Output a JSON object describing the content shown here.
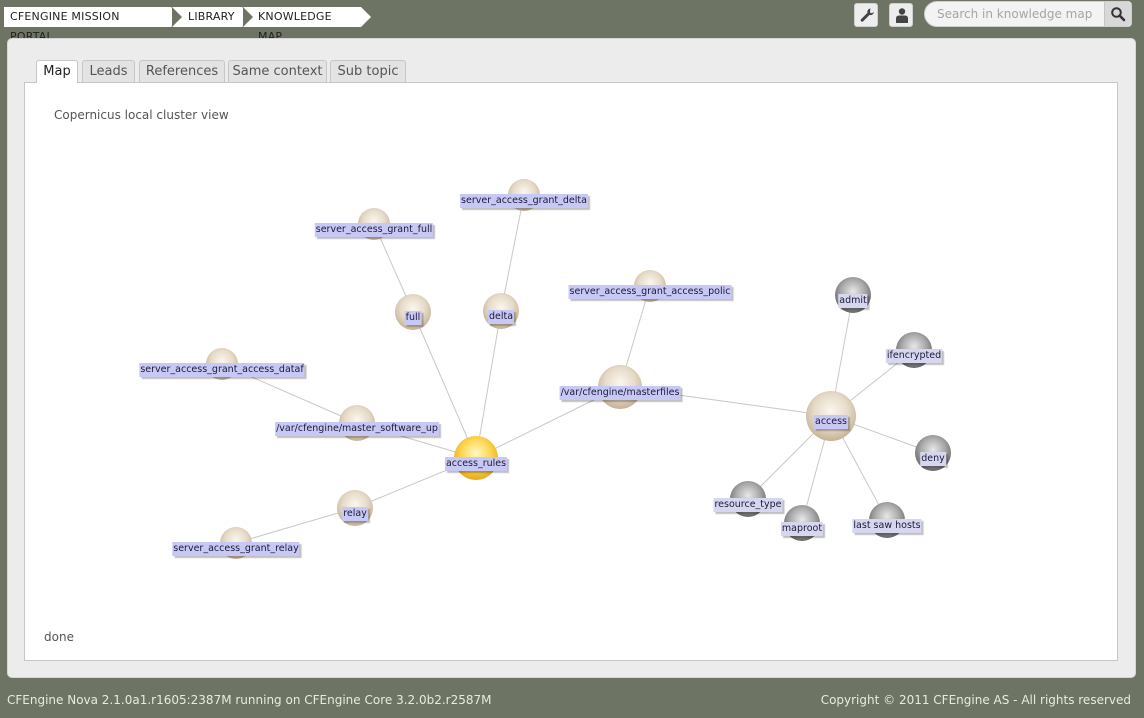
{
  "breadcrumbs": [
    "CFENGINE MISSION PORTAL",
    "LIBRARY",
    "KNOWLEDGE MAP"
  ],
  "toolbar": {
    "settings_icon": "wrench-icon",
    "user_icon": "user-icon"
  },
  "search": {
    "placeholder": "Search in knowledge map",
    "icon": "magnifier-icon"
  },
  "tabs": [
    "Map",
    "Leads",
    "References",
    "Same context",
    "Sub topic"
  ],
  "active_tab": "Map",
  "map": {
    "title": "Copernicus local cluster view",
    "status": "done",
    "colors": {
      "focus": "#f5c842",
      "topic": "#d9cbb5",
      "remote": "#8f8f8f",
      "label_bg": "#c8c8f5",
      "edge": "#c8c8c8"
    },
    "nodes": [
      {
        "id": "access_rules",
        "label": "access_rules",
        "kind": "focus"
      },
      {
        "id": "full",
        "label": "full",
        "kind": "topic"
      },
      {
        "id": "delta",
        "label": "delta",
        "kind": "topic"
      },
      {
        "id": "sag_full",
        "label": "server_access_grant_full",
        "kind": "topic"
      },
      {
        "id": "sag_delta",
        "label": "server_access_grant_delta",
        "kind": "topic"
      },
      {
        "id": "sag_dataf",
        "label": "server_access_grant_access_dataf",
        "kind": "topic"
      },
      {
        "id": "master_sw",
        "label": "/var/cfengine/master_software_up",
        "kind": "topic"
      },
      {
        "id": "relay",
        "label": "relay",
        "kind": "topic"
      },
      {
        "id": "sag_relay",
        "label": "server_access_grant_relay",
        "kind": "topic"
      },
      {
        "id": "masterfiles",
        "label": "/var/cfengine/masterfiles",
        "kind": "topic"
      },
      {
        "id": "sag_polic",
        "label": "server_access_grant_access_polic",
        "kind": "topic"
      },
      {
        "id": "access",
        "label": "access",
        "kind": "topic"
      },
      {
        "id": "admit",
        "label": "admit",
        "kind": "remote"
      },
      {
        "id": "ifencrypted",
        "label": "ifencrypted",
        "kind": "remote"
      },
      {
        "id": "deny",
        "label": "deny",
        "kind": "remote"
      },
      {
        "id": "last_saw",
        "label": "last saw hosts",
        "kind": "remote"
      },
      {
        "id": "maproot",
        "label": "maproot",
        "kind": "remote"
      },
      {
        "id": "resource_type",
        "label": "resource_type",
        "kind": "remote"
      }
    ],
    "edges": [
      [
        "access_rules",
        "full"
      ],
      [
        "access_rules",
        "delta"
      ],
      [
        "access_rules",
        "master_sw"
      ],
      [
        "access_rules",
        "relay"
      ],
      [
        "access_rules",
        "masterfiles"
      ],
      [
        "full",
        "sag_full"
      ],
      [
        "delta",
        "sag_delta"
      ],
      [
        "master_sw",
        "sag_dataf"
      ],
      [
        "relay",
        "sag_relay"
      ],
      [
        "masterfiles",
        "sag_polic"
      ],
      [
        "masterfiles",
        "access"
      ],
      [
        "access",
        "admit"
      ],
      [
        "access",
        "ifencrypted"
      ],
      [
        "access",
        "deny"
      ],
      [
        "access",
        "last_saw"
      ],
      [
        "access",
        "maproot"
      ],
      [
        "access",
        "resource_type"
      ]
    ]
  },
  "footer": {
    "version": "CFEngine Nova 2.1.0a1.r1605:2387M running on CFEngine Core 3.2.0b2.r2587M",
    "copyright": "Copyright © 2011 CFEngine AS - All rights reserved"
  }
}
